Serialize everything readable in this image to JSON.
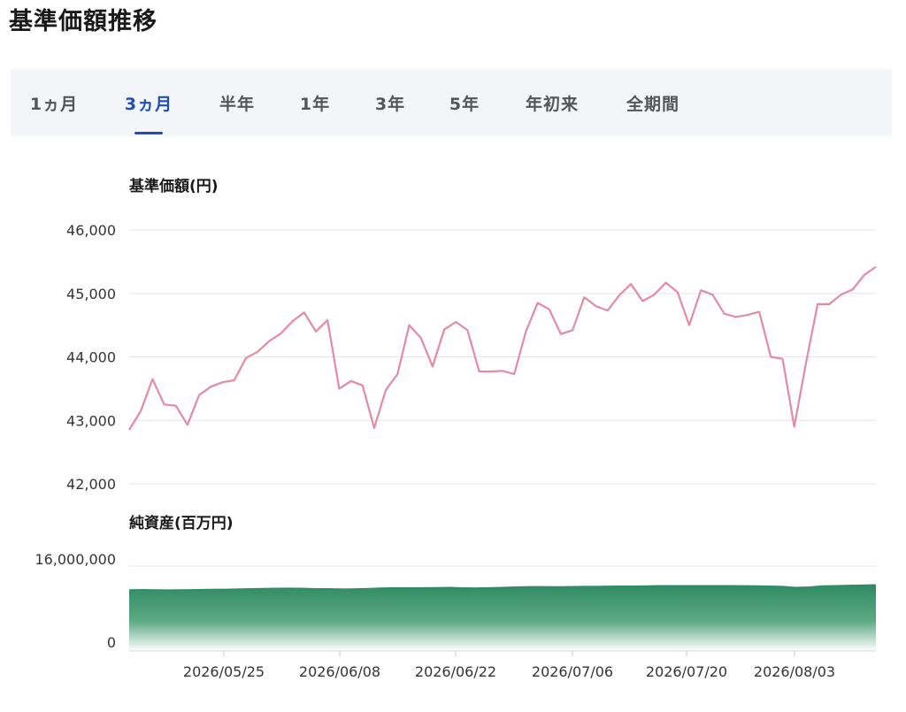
{
  "page": {
    "title": "基準価額推移"
  },
  "tabs": [
    {
      "label": "1ヵ月",
      "active": false
    },
    {
      "label": "3ヵ月",
      "active": true
    },
    {
      "label": "半年",
      "active": false
    },
    {
      "label": "1年",
      "active": false
    },
    {
      "label": "3年",
      "active": false
    },
    {
      "label": "5年",
      "active": false
    },
    {
      "label": "年初来",
      "active": false
    },
    {
      "label": "全期間",
      "active": false
    }
  ],
  "colors": {
    "accent": "#1f4fb3",
    "price_line": "#e58aa3",
    "net_assets_fill_top": "#2e8b63",
    "net_assets_fill_bottom": "#ffffff"
  },
  "chart_data": [
    {
      "type": "line",
      "ylabel": "基準価額(円)",
      "ylim": [
        42000,
        46000
      ],
      "yticks": [
        46000,
        45000,
        44000,
        43000,
        42000
      ],
      "ytick_labels": [
        "46,000",
        "45,000",
        "44,000",
        "43,000",
        "42,000"
      ],
      "grid": true,
      "series": [
        {
          "values": [
            42850,
            43150,
            43650,
            43250,
            43230,
            42930,
            43400,
            43530,
            43600,
            43630,
            43980,
            44080,
            44250,
            44370,
            44560,
            44700,
            44400,
            44580,
            43500,
            43620,
            43550,
            42880,
            43480,
            43730,
            44500,
            44300,
            43850,
            44430,
            44550,
            44420,
            43770,
            43770,
            43780,
            43730,
            44400,
            44850,
            44750,
            44360,
            44420,
            44940,
            44800,
            44730,
            44970,
            45150,
            44880,
            44980,
            45170,
            45020,
            44500,
            45050,
            44980,
            44680,
            44630,
            44660,
            44710,
            44000,
            43970,
            42900,
            43900,
            44830,
            44830,
            44980,
            45060,
            45290,
            45420
          ]
        }
      ]
    },
    {
      "type": "area",
      "ylabel": "純資産(百万円)",
      "ylim": [
        0,
        16000000
      ],
      "yticks": [
        16000000,
        0
      ],
      "ytick_labels": [
        "16,000,000",
        "0"
      ],
      "grid": true,
      "xtick_labels": [
        "2026/05/25",
        "2026/06/08",
        "2026/06/22",
        "2026/07/06",
        "2026/07/20",
        "2026/08/03"
      ],
      "series": [
        {
          "values": [
            11500000,
            11550000,
            11500000,
            11480000,
            11500000,
            11550000,
            11580000,
            11600000,
            11650000,
            11700000,
            11750000,
            11800000,
            11820000,
            11800000,
            11700000,
            11720000,
            11650000,
            11680000,
            11750000,
            11850000,
            11900000,
            11880000,
            11900000,
            11920000,
            11950000,
            11880000,
            11850000,
            11900000,
            11950000,
            12050000,
            12100000,
            12100000,
            12080000,
            12100000,
            12150000,
            12150000,
            12180000,
            12200000,
            12220000,
            12250000,
            12280000,
            12300000,
            12300000,
            12280000,
            12300000,
            12280000,
            12270000,
            12250000,
            12200000,
            12150000,
            11950000,
            12050000,
            12250000,
            12300000,
            12350000,
            12400000,
            12450000
          ]
        }
      ]
    }
  ]
}
